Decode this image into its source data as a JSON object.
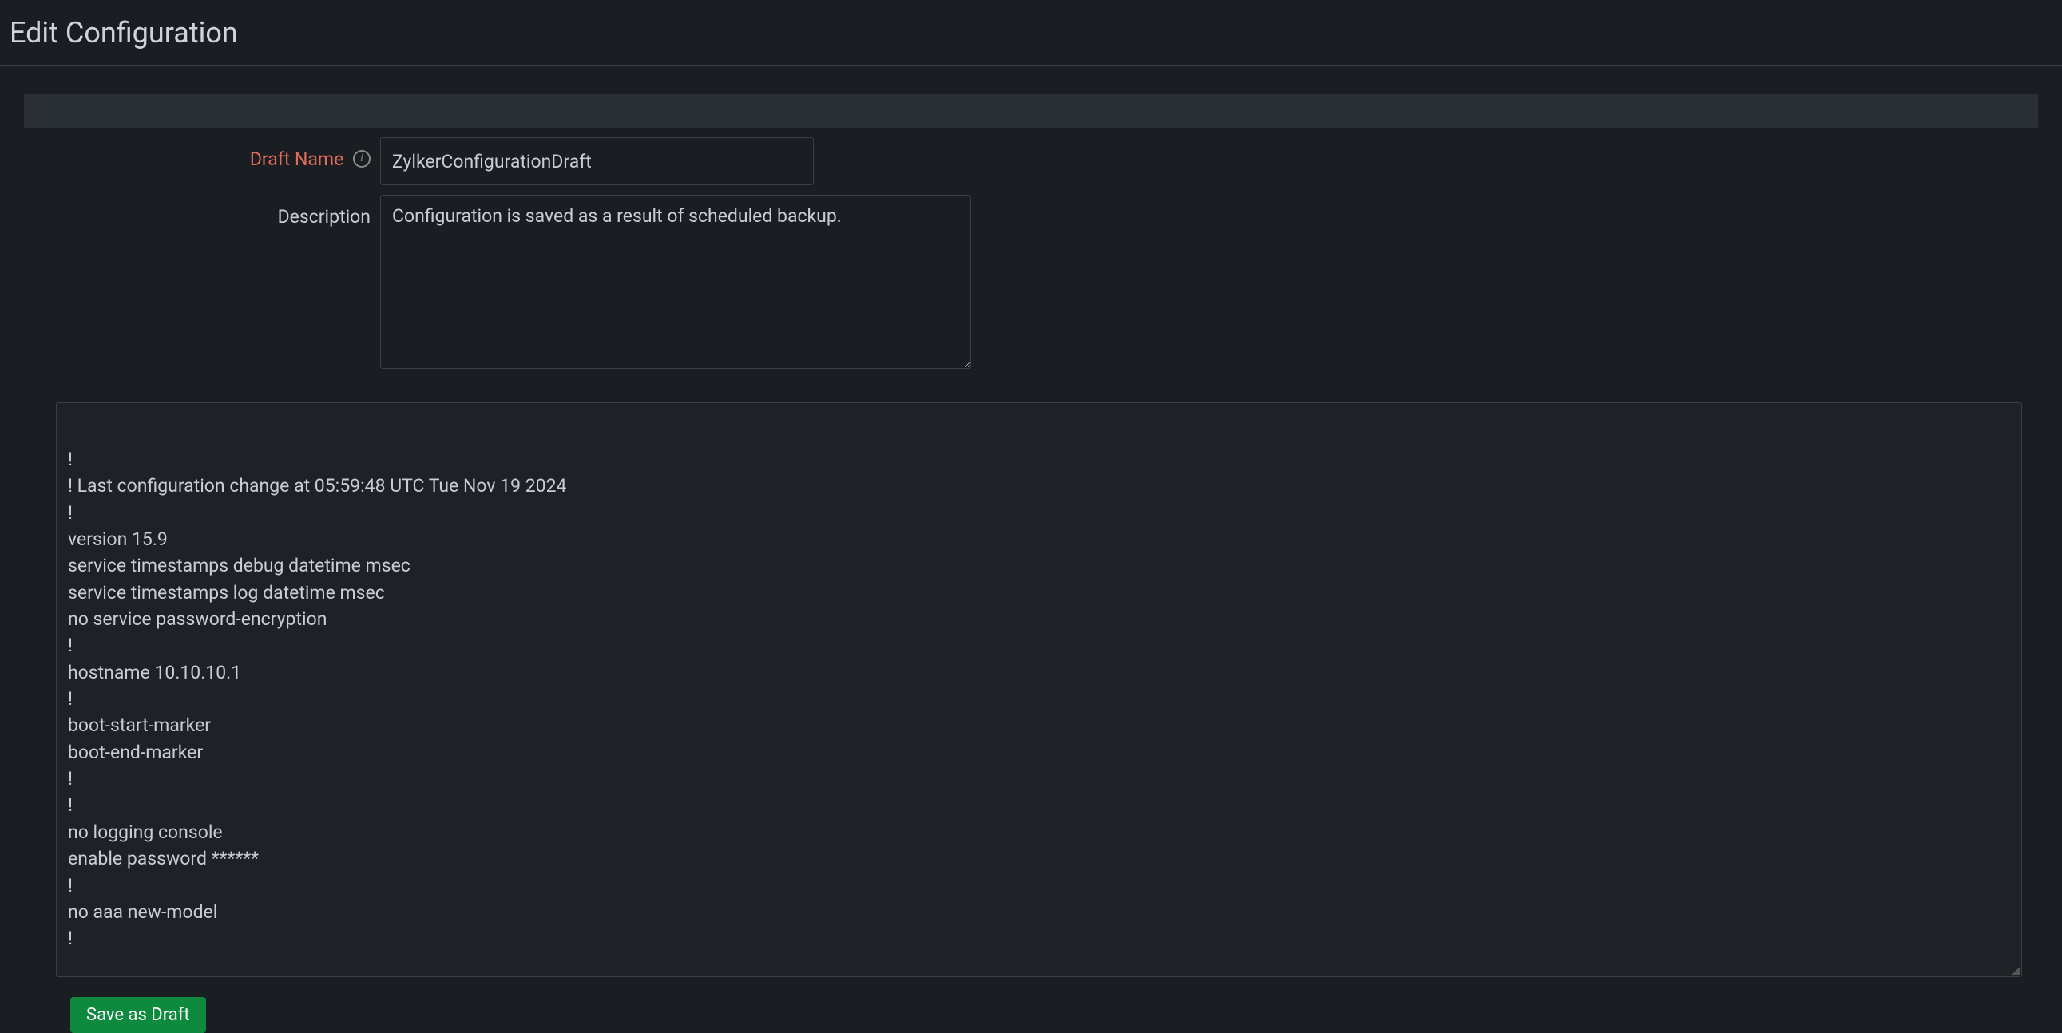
{
  "header": {
    "title": "Edit Configuration"
  },
  "form": {
    "draft_name_label": "Draft Name",
    "draft_name_value": "ZylkerConfigurationDraft",
    "description_label": "Description",
    "description_value": "Configuration is saved as a result of scheduled backup."
  },
  "config_text": "!\n! Last configuration change at 05:59:48 UTC Tue Nov 19 2024\n!\nversion 15.9\nservice timestamps debug datetime msec\nservice timestamps log datetime msec\nno service password-encryption\n!\nhostname 10.10.10.1\n!\nboot-start-marker\nboot-end-marker\n!\n!\nno logging console\nenable password ******\n!\nno aaa new-model\n!",
  "actions": {
    "save_label": "Save as Draft"
  }
}
